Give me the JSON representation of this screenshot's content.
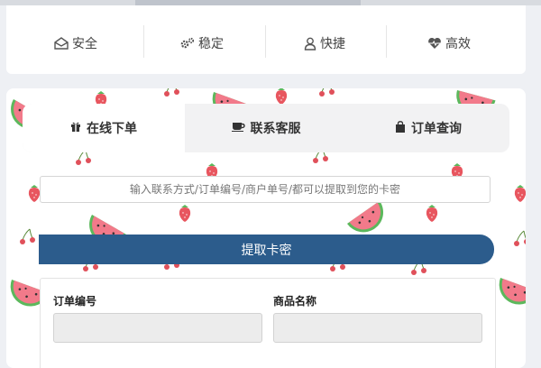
{
  "features": [
    {
      "label": "安全",
      "icon": "envelope-open-icon"
    },
    {
      "label": "稳定",
      "icon": "gears-icon"
    },
    {
      "label": "快捷",
      "icon": "user-icon"
    },
    {
      "label": "高效",
      "icon": "heartbeat-icon"
    }
  ],
  "tabs": [
    {
      "label": "在线下单",
      "icon": "gift-icon",
      "active": true
    },
    {
      "label": "联系客服",
      "icon": "coffee-cup-icon",
      "active": false
    },
    {
      "label": "订单查询",
      "icon": "shopping-bag-icon",
      "active": false
    }
  ],
  "query": {
    "placeholder": "输入联系方式/订单编号/商户单号/都可以提取到您的卡密",
    "value": "",
    "button_label": "提取卡密"
  },
  "result": {
    "order_number_label": "订单编号",
    "product_name_label": "商品名称"
  },
  "colors": {
    "accent": "#2c5c8c",
    "watermelon_flesh": "#f27a8a",
    "watermelon_rind": "#5cb85c"
  }
}
